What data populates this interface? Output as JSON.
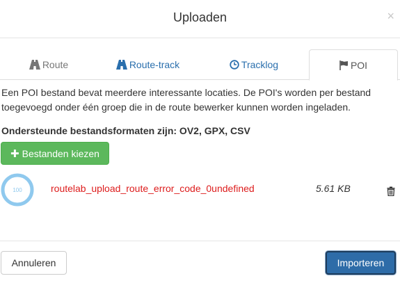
{
  "modal": {
    "title": "Uploaden",
    "close_glyph": "×"
  },
  "tabs": [
    {
      "label": "Route",
      "icon": "road-icon",
      "active": false
    },
    {
      "label": "Route-track",
      "icon": "road-icon",
      "active": false
    },
    {
      "label": "Tracklog",
      "icon": "clock-icon",
      "active": false
    },
    {
      "label": "POI",
      "icon": "flag-icon",
      "active": true
    }
  ],
  "content": {
    "description": "Een POI bestand bevat meerdere interessante locaties. De POI's worden per bestand toegevoegd onder één groep die in de route bewerker kunnen worden ingeladen.",
    "formats_label": "Ondersteunde bestandsformaten zijn: OV2, GPX, CSV",
    "choose_button": {
      "icon": "plus-icon",
      "label": "Bestanden kiezen"
    },
    "files": [
      {
        "progress_text": "100",
        "progress_percent": 100,
        "name": "routelab_upload_route_error_code_0undefined",
        "size": "5.61 KB",
        "delete_icon": "trash-icon"
      }
    ]
  },
  "footer": {
    "cancel_label": "Annuleren",
    "import_label": "Importeren"
  },
  "colors": {
    "green_button": "#5cb85c",
    "primary_button": "#2e6ca8",
    "error_text": "#dd1c1c",
    "link_tab": "#2a6fad",
    "progress_ring": "#8fc9ee"
  }
}
